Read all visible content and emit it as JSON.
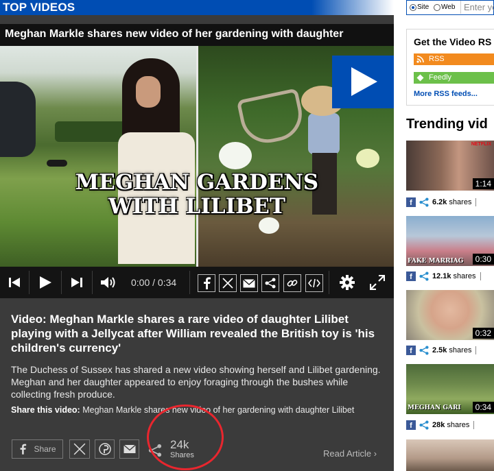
{
  "section": {
    "title": "TOP VIDEOS"
  },
  "video": {
    "title": "Meghan Markle shares new video of her gardening with daughter",
    "overlay_lines": [
      "MEGHAN GARDENS",
      "WITH LILIBET"
    ],
    "time_display": "0:00 / 0:34",
    "headline": "Video: Meghan Markle shares a rare video of daughter Lilibet playing with a Jellycat after William revealed the British toy is 'his children's currency'",
    "description": "The Duchess of Sussex has shared a new video showing herself and Lilibet gardening. Meghan and her daughter appeared to enjoy foraging through the bushes while collecting fresh produce.",
    "share_label": "Share this video:",
    "share_text": "Meghan Markle shares new video of her gardening with daughter Lilibet",
    "facebook_share_label": "Share",
    "share_count": "24k",
    "share_count_label": "Shares",
    "read_article": "Read Article"
  },
  "search": {
    "site_label": "Site",
    "web_label": "Web",
    "placeholder": "Enter yo"
  },
  "rss": {
    "title": "Get the Video RS",
    "rss_label": "RSS",
    "feedly_label": "Feedly",
    "more_label": "More RSS feeds..."
  },
  "trending": {
    "title": "Trending vid",
    "items": [
      {
        "duration": "1:14",
        "shares": "6.2k",
        "shares_label": "shares",
        "brand": "NETFLIX"
      },
      {
        "duration": "0:30",
        "shares": "12.1k",
        "shares_label": "shares",
        "caption": "FAKE MARRIAG"
      },
      {
        "duration": "0:32",
        "shares": "2.5k",
        "shares_label": "shares"
      },
      {
        "duration": "0:34",
        "shares": "28k",
        "shares_label": "shares",
        "caption": "MEGHAN GARI"
      }
    ]
  },
  "colors": {
    "brand_blue": "#004db3",
    "annotation_red": "#e8262e",
    "rss_orange": "#f28a1e",
    "feedly_green": "#6cc04a",
    "facebook_blue": "#3b5998"
  }
}
